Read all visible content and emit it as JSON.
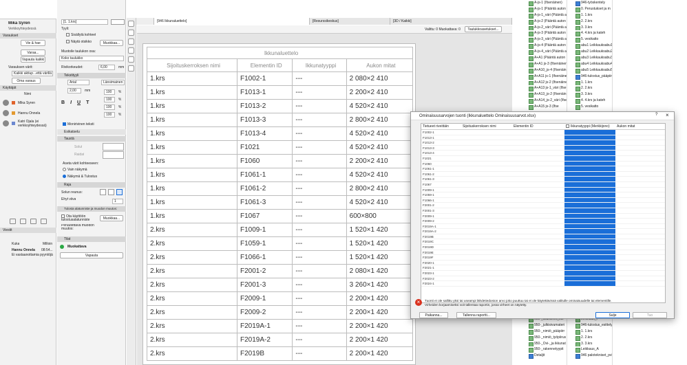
{
  "left_panel": {
    "user": "Mika Syren",
    "workspace": "Verkkoyhteydessä",
    "reservations_title": "Varaukset",
    "export_label": "Vie & hae",
    "reserve_label": "Varaa...",
    "release_all_label": "Vapauta kaikki",
    "reserve_colors_label": "Varauksen värit:",
    "all_reserved_label": "Kaikki aktiup...että värillä",
    "own_reservation_label": "Oma varaus",
    "users_title": "Käyttäjät",
    "name_header": "Nimi",
    "users": [
      {
        "name": "Mika Syren",
        "color": "#e0632c"
      },
      {
        "name": "Hannu Onnela",
        "color": "#e39a30"
      },
      {
        "name": "Katri Ojala (ei verkkoyhteydessä)",
        "color": "#6c88d0"
      }
    ],
    "messages_title": "Viestit",
    "who_header": "Kuka",
    "when_header": "Milloin",
    "message_from": "Hannu Onnela",
    "message_time": "08:54...",
    "message_text": "Ei vastaanottamia pyyntöjä"
  },
  "settings_panel": {
    "tab_label": "[1. 1.krs]",
    "type_label": "Tyyli:",
    "include_title": "Sisällytä kohteet",
    "show_in_schedule": "Näytä otsikko",
    "modify_label": "Muokkaa...",
    "schedule_style_label": "Muotoile taulukon osa:",
    "schedule_style_value": "Koko taulukko",
    "row_height_label": "Rivikorkeudet:",
    "row_height_value": "6,00",
    "unit": "mm",
    "text_style_title": "Tekstityyli",
    "font_value": "Arial",
    "font_size_value": "2,00",
    "align_value": "Länsimainen",
    "b": "B",
    "i": "I",
    "u": "U",
    "t": "T",
    "percent": "%",
    "scale_1": "100",
    "scale_2": "100",
    "scale_3": "100",
    "scale_4": "100",
    "multiline_label": "Monirivinen teksti",
    "reset_label": "Esikatselu",
    "fill_title": "Taustä",
    "solid_label": "Solut",
    "cells_label": "Raidat",
    "apply_color_label": "Aseta värit kohteeseen:",
    "only_view": "Vain näkymä",
    "view_and_results": "Näkymä & Tulostus",
    "frame_title": "Raja",
    "cell_frame_label": "Solun reunus:",
    "line_value": "Ehyt viiva",
    "line_width": "1",
    "update_title": "Tulosta alatunniste ja muodon muutos:",
    "use_label": "Ota käyttöön tulostusalatunniste",
    "modify2_label": "Muokkaa...",
    "template_label": "Peruutettävä muodon muutos:",
    "status_title": "Tilat",
    "status_value": "Muokattava",
    "release_label": "Vapauta"
  },
  "tabs": [
    {
      "label": "[946 Ikkunaluettelo]",
      "active": true
    },
    {
      "label": "[Resurssikeskus]",
      "active": false
    },
    {
      "label": "[3D / Kaikki]",
      "active": false
    }
  ],
  "toolbar": {
    "selected_label": "Valittu: 0 Muokattava: 0",
    "schedule_settings_label": "Taulukkoasetukset..."
  },
  "schedule": {
    "title": "Ikkunaluettelo",
    "headers": [
      "Sijoituskerroksen nimi",
      "Elementin ID",
      "Ikkunatyyppi",
      "Aukon mitat"
    ],
    "rows": [
      [
        "1.krs",
        "F1002-1",
        "---",
        "2 080×2 410"
      ],
      [
        "1.krs",
        "F1013-1",
        "---",
        "2 200×2 410"
      ],
      [
        "1.krs",
        "F1013-2",
        "---",
        "4 520×2 410"
      ],
      [
        "1.krs",
        "F1013-3",
        "---",
        "2 800×2 410"
      ],
      [
        "1.krs",
        "F1013-4",
        "---",
        "4 520×2 410"
      ],
      [
        "1.krs",
        "F1021",
        "---",
        "4 520×2 410"
      ],
      [
        "1.krs",
        "F1060",
        "---",
        "2 200×2 410"
      ],
      [
        "1.krs",
        "F1061-1",
        "---",
        "4 520×2 410"
      ],
      [
        "1.krs",
        "F1061-2",
        "---",
        "2 800×2 410"
      ],
      [
        "1.krs",
        "F1061-3",
        "---",
        "4 520×2 410"
      ],
      [
        "1.krs",
        "F1067",
        "---",
        "600×800"
      ],
      [
        "2.krs",
        "F1009-1",
        "---",
        "1 520×1 420"
      ],
      [
        "2.krs",
        "F1059-1",
        "---",
        "1 520×1 420"
      ],
      [
        "2.krs",
        "F1066-1",
        "---",
        "1 520×1 420"
      ],
      [
        "2.krs",
        "F2001-2",
        "---",
        "2 080×1 420"
      ],
      [
        "2.krs",
        "F2001-3",
        "---",
        "3 260×1 420"
      ],
      [
        "2.krs",
        "F2009-1",
        "---",
        "2 200×1 420"
      ],
      [
        "2.krs",
        "F2009-2",
        "---",
        "2 200×1 420"
      ],
      [
        "2.krs",
        "F2019A-1",
        "---",
        "2 200×1 420"
      ],
      [
        "2.krs",
        "F2019A-2",
        "---",
        "2 200×1 420"
      ],
      [
        "2.krs",
        "F2019B",
        "---",
        "2 200×1 420"
      ]
    ]
  },
  "navigator": {
    "col1": [
      "A-js-1 (Ifsenäinen)",
      "A-js-1 (Pääntä auton",
      "A-js-1_väri (Pääntä a",
      "A-js-2 (Pääntä auton",
      "A-js-2_väri (Pääntä a",
      "A-js-3 (Pääntä auton",
      "A-js-3_väri (Pääntä a",
      "A-js-4 (Pääntä auton",
      "A-js-4_väri (Pääntä a",
      "A+A1 (Pääntä auton",
      "A+A1 js-3 (Ifsenäinen",
      "A+A10_js-4 (Ifsenäin",
      "A+A11 js-1 (Ifsenäine",
      "A+A12 js-2 (Ifsenäine",
      "A+A13 js-1_väri (Ifse",
      "A+A13_js-2 (Ifsenäin",
      "A+A14_js-2_väri (Ifse",
      "A+A15 js-3 (Ifse"
    ],
    "col2": [
      "946-työskentely",
      "0. Perustukset ja m",
      "1. 1.krs",
      "2. 2.krs",
      "3. 3.krs",
      "4. 4.krs ja kateh",
      "5. vesikatto",
      "abu1 Leikkauksabu1",
      "abu2 Leikkauksabu2",
      "abu3 Leikkauksabu3",
      "abu4 Leikkauksabu4",
      "abu5 Leikkauksabu5",
      "946-tulostus_pääpiirr",
      "1. 1.krs",
      "2. 2.krs",
      "3. 3.krs",
      "4. 4.krs ja kateh",
      "5. vesikatto"
    ],
    "bottom_col1": [
      "950-_lisdellinet_kor",
      "950-_julkisivumateri",
      "950-_nimiö_pääpiirr",
      "950-_nimiö_työpiirus",
      "950-_Ovi-_ja ikkunat",
      "950-_rakennetyypit"
    ],
    "bottom_col2": [
      "Leikkaus_F",
      "946-tulostus_esittely",
      "1. 1.krs",
      "2. 2.krs",
      "3. 3.krs",
      "Leikkaus_A"
    ],
    "details_label": "Detaljit",
    "pdf_label": "946 palotekniset_pvl"
  },
  "dialog": {
    "title": "Ominaisuusarvojen tuonti (Ikkunaluettelo Ominaisuusarvot.xlsx)",
    "help": "?",
    "close": "×",
    "headers": [
      "Tietueet riveittäin",
      "Sijoituskerroksen nimi",
      "Elementin ID",
      "Ikkunatyyppi (Merkkijono)",
      "Aukon mitat"
    ],
    "rows": [
      "F1002-1",
      "F1013-1",
      "F1013-2",
      "F1013-3",
      "F1013-4",
      "F1021",
      "F1060",
      "F1061-1",
      "F1061-2",
      "F1061-3",
      "F1067",
      "F1009-1",
      "F1059-1",
      "F1066-1",
      "F2001-2",
      "F2001-3",
      "F2009-1",
      "F2009-2",
      "F2019A-1",
      "F2019A-2",
      "F2019B",
      "F2019C",
      "F2019D",
      "F2019E",
      "F2019F",
      "F2020-1",
      "F2021-1",
      "F2023-1",
      "F2023-2",
      "F2024-1"
    ],
    "warning": "Tuonti ei ole sallittu yksi tai useampi lähdetiedoston arvo joko puuttuu tai ei ole käytettävissä valitulle ominaisuudelle tai elementille. Virheiden korjaamiseksi voit tallentaa raportin, jossa virheet on näytetty.",
    "cancel_label": "Paikanna...",
    "save_report_label": "Tallenna raportti...",
    "ok_label": "Sulje",
    "import_label": "Tuo",
    "accent": "#1a6ed8",
    "error_color": "#d9321f"
  }
}
